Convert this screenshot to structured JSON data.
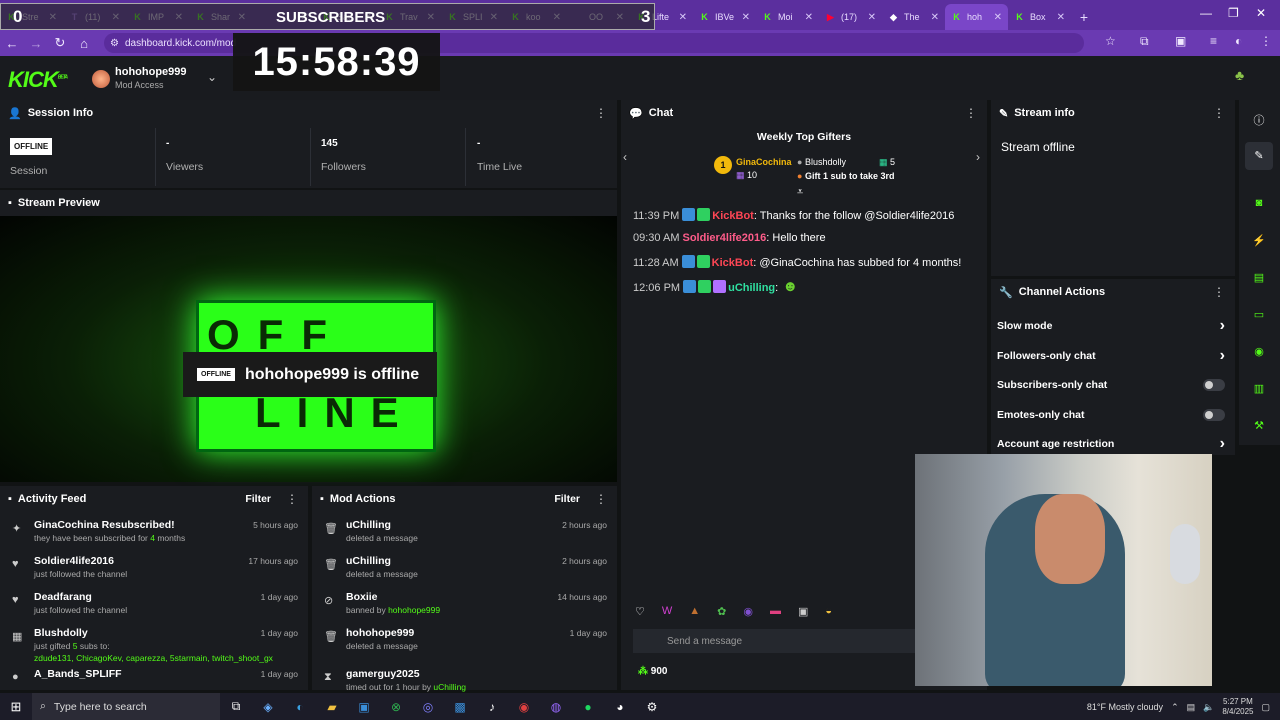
{
  "browser": {
    "tabs": [
      {
        "title": "Stre",
        "fav": "K",
        "color": "#53fc18"
      },
      {
        "title": "(11)",
        "fav": "T",
        "color": "#a970ff"
      },
      {
        "title": "IMP",
        "fav": "K",
        "color": "#53fc18"
      },
      {
        "title": "Shar",
        "fav": "K",
        "color": "#53fc18"
      },
      {
        "title": "",
        "fav": "",
        "color": "#888"
      },
      {
        "title": "Sau",
        "fav": "K",
        "color": "#53fc18"
      },
      {
        "title": "Trav",
        "fav": "K",
        "color": "#53fc18"
      },
      {
        "title": "SPLI",
        "fav": "K",
        "color": "#53fc18"
      },
      {
        "title": "koo",
        "fav": "K",
        "color": "#53fc18"
      },
      {
        "title": "OO",
        "fav": "",
        "color": "#888"
      },
      {
        "title": "Lifte",
        "fav": "K",
        "color": "#53fc18"
      },
      {
        "title": "IBVe",
        "fav": "K",
        "color": "#53fc18"
      },
      {
        "title": "Moi",
        "fav": "K",
        "color": "#53fc18"
      },
      {
        "title": "(17)",
        "fav": "▶",
        "color": "#ff0033"
      },
      {
        "title": "The",
        "fav": "◆",
        "color": "#ffffff"
      },
      {
        "title": "hoh",
        "fav": "K",
        "color": "#53fc18",
        "active": true
      },
      {
        "title": "Box",
        "fav": "K",
        "color": "#53fc18"
      }
    ],
    "url": "dashboard.kick.com/mod"
  },
  "overlay": {
    "sub_left": "0",
    "sub_label": "SUBSCRIBERS",
    "sub_right": "3",
    "clock": "15:58:39"
  },
  "header": {
    "logo": "KICK",
    "logo_tag": "BETA",
    "username": "hohohope999",
    "role": "Mod Access"
  },
  "session": {
    "title": "Session Info",
    "badge": "OFFLINE",
    "session_label": "Session",
    "stats": [
      {
        "value": "-",
        "label": "Viewers"
      },
      {
        "value": "145",
        "label": "Followers"
      },
      {
        "value": "-",
        "label": "Time Live"
      }
    ]
  },
  "preview": {
    "title": "Stream Preview",
    "badge": "OFFLINE",
    "message": "hohohope999 is offline",
    "sign_top": "OFF",
    "sign_bottom": "LINE"
  },
  "activity": {
    "title": "Activity Feed",
    "filter": "Filter",
    "items": [
      {
        "icon": "✦",
        "name": "GinaCochina Resubscribed!",
        "sub_pre": "they have been subscribed for ",
        "sub_hl": "4",
        "sub_post": " months",
        "time": "5 hours ago"
      },
      {
        "icon": "♥",
        "name": "Soldier4life2016",
        "sub_pre": "just followed the channel",
        "sub_hl": "",
        "sub_post": "",
        "time": "17 hours ago"
      },
      {
        "icon": "♥",
        "name": "Deadfarang",
        "sub_pre": "just followed the channel",
        "sub_hl": "",
        "sub_post": "",
        "time": "1 day ago"
      },
      {
        "icon": "▦",
        "name": "Blushdolly",
        "sub_pre": "just gifted ",
        "sub_hl": "5",
        "sub_post": " subs to:",
        "time": "1 day ago",
        "extra": "zdude131, ChicagoKev, caparezza, 5starmain, twitch_shoot_gx"
      },
      {
        "icon": "●",
        "name": "A_Bands_SPLIFF",
        "sub_pre": "",
        "sub_hl": "",
        "sub_post": "",
        "time": "1 day ago"
      }
    ]
  },
  "modactions": {
    "title": "Mod Actions",
    "filter": "Filter",
    "items": [
      {
        "icon": "🗑",
        "name": "uChilling",
        "sub_pre": "deleted a message",
        "sub_hl": "",
        "time": "2 hours ago"
      },
      {
        "icon": "🗑",
        "name": "uChilling",
        "sub_pre": "deleted a message",
        "sub_hl": "",
        "time": "2 hours ago"
      },
      {
        "icon": "⊘",
        "name": "Boxiie",
        "sub_pre": "banned by ",
        "sub_hl": "hohohope999",
        "time": "14 hours ago"
      },
      {
        "icon": "🗑",
        "name": "hohohope999",
        "sub_pre": "deleted a message",
        "sub_hl": "",
        "time": "1 day ago"
      },
      {
        "icon": "⧗",
        "name": "gamerguy2025",
        "sub_pre": "timed out for 1 hour by ",
        "sub_hl": "uChilling",
        "time": ""
      }
    ]
  },
  "chat": {
    "title": "Chat",
    "gifters_title": "Weekly Top Gifters",
    "gifter1": {
      "rank": "1",
      "name": "GinaCochina",
      "count": "10"
    },
    "gifter2": {
      "name": "Blushdolly",
      "count": "5",
      "cta": "Gift 1 sub to take 3rd"
    },
    "messages": [
      {
        "time": "11:39 PM",
        "user": "KickBot",
        "ucolor": "#ff4655",
        "text": ": Thanks for the follow @Soldier4life2016",
        "badges": 2
      },
      {
        "time": "09:30 AM",
        "user": "Soldier4life2016",
        "ucolor": "#ff5c8a",
        "text": ": Hello there",
        "badges": 0
      },
      {
        "time": "11:28 AM",
        "user": "KickBot",
        "ucolor": "#ff4655",
        "text": ": @GinaCochina has subbed for 4 months!",
        "badges": 2
      },
      {
        "time": "12:06 PM",
        "user": "uChilling",
        "ucolor": "#2fe0a0",
        "text": ":",
        "badges": 3
      }
    ],
    "placeholder": "Send a message",
    "points": "900"
  },
  "streaminfo": {
    "title": "Stream info",
    "status": "Stream offline"
  },
  "channel": {
    "title": "Channel Actions",
    "actions": [
      {
        "label": "Slow mode",
        "kind": "arrow"
      },
      {
        "label": "Followers-only chat",
        "kind": "arrow"
      },
      {
        "label": "Subscribers-only chat",
        "kind": "toggle"
      },
      {
        "label": "Emotes-only chat",
        "kind": "toggle"
      },
      {
        "label": "Account age restriction",
        "kind": "arrow"
      }
    ]
  },
  "taskbar": {
    "search": "Type here to search",
    "weather": "81°F  Mostly cloudy",
    "time": "5:27 PM",
    "date": "8/4/2025"
  },
  "colors": {
    "kick_green": "#53fc18",
    "browser_purple": "#5b2f9e",
    "panel": "#1a1c20"
  }
}
